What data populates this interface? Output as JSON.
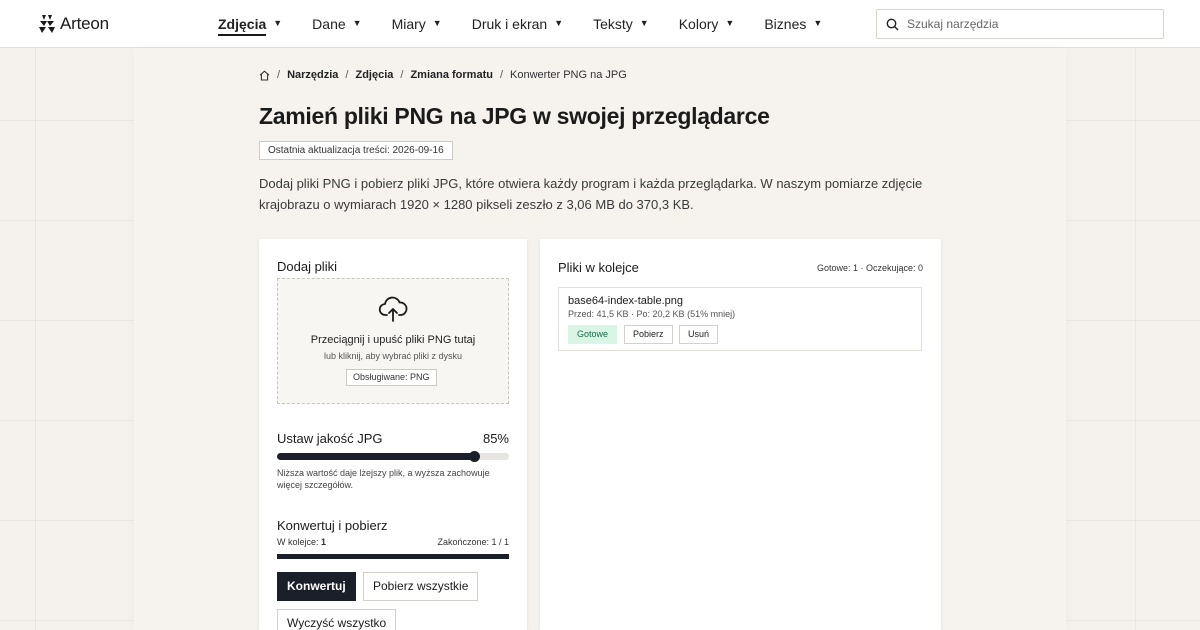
{
  "brand": {
    "name": "Arteon"
  },
  "nav": {
    "items": [
      {
        "label": "Zdjęcia",
        "active": true
      },
      {
        "label": "Dane"
      },
      {
        "label": "Miary"
      },
      {
        "label": "Druk i ekran"
      },
      {
        "label": "Teksty"
      },
      {
        "label": "Kolory"
      },
      {
        "label": "Biznes"
      }
    ]
  },
  "search": {
    "placeholder": "Szukaj narzędzia"
  },
  "breadcrumb": {
    "items": [
      "Narzędzia",
      "Zdjęcia",
      "Zmiana formatu"
    ],
    "current": "Konwerter PNG na JPG"
  },
  "page": {
    "title": "Zamień pliki PNG na JPG w swojej przeglądarce",
    "updated": "Ostatnia aktualizacja treści: 2026-09-16",
    "description": "Dodaj pliki PNG i pobierz pliki JPG, które otwiera każdy program i każda przeglądarka. W naszym pomiarze zdjęcie krajobrazu o wymiarach 1920 × 1280 pikseli zeszło z 3,06 MB do 370,3 KB."
  },
  "upload": {
    "title": "Dodaj pliki",
    "drop_main": "Przeciągnij i upuść pliki PNG tutaj",
    "drop_sub": "lub kliknij, aby wybrać pliki z dysku",
    "supported": "Obsługiwane: PNG"
  },
  "quality": {
    "title": "Ustaw jakość JPG",
    "value_label": "85%",
    "value": 0.85,
    "hint": "Niższa wartość daje lżejszy plik, a wyższa zachowuje więcej szczegółów."
  },
  "convert": {
    "title": "Konwertuj i pobierz",
    "queued_label": "W kolejce:",
    "queued_value": "1",
    "done_label": "Zakończone: 1 / 1",
    "progress": 1.0,
    "btn_convert": "Konwertuj",
    "btn_download_all": "Pobierz wszystkie",
    "btn_clear": "Wyczyść wszystko"
  },
  "queue": {
    "title": "Pliki w kolejce",
    "stats": "Gotowe: 1 · Oczekujące: 0",
    "items": [
      {
        "name": "base64-index-table.png",
        "meta": "Przed: 41,5 KB · Po: 20,2 KB (51% mniej)",
        "status": "Gotowe",
        "download": "Pobierz",
        "remove": "Usuń"
      }
    ]
  },
  "colors": {
    "accent": "#1b1f2a",
    "success_bg": "#d8f5e6",
    "success_text": "#1d6b45"
  }
}
